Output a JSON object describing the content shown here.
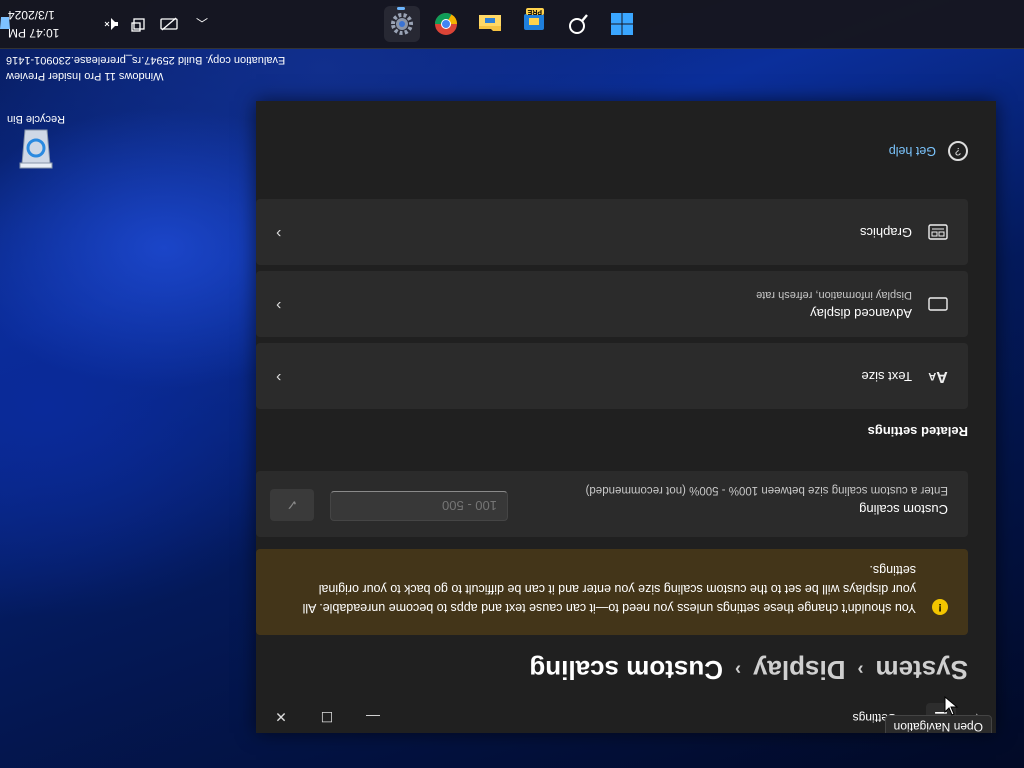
{
  "desktop": {
    "recycle_bin_label": "Recycle Bin",
    "watermark_line1": "Windows 11 Pro Insider Preview",
    "watermark_line2": "Evaluation copy. Build 25947.rs_prerelease.230901-1416"
  },
  "taskbar": {
    "apps": [
      {
        "name": "Start",
        "icon": "windows-logo-icon"
      },
      {
        "name": "Search",
        "icon": "search-icon"
      },
      {
        "name": "Store",
        "icon": "store-icon",
        "badge": "PRE"
      },
      {
        "name": "File Explorer",
        "icon": "folder-icon"
      },
      {
        "name": "Chrome",
        "icon": "chrome-icon"
      },
      {
        "name": "Settings",
        "icon": "gear-icon",
        "active": true
      }
    ],
    "clock_time": "10:47 PM",
    "clock_date": "1/3/2024"
  },
  "window": {
    "app_title": "Settings",
    "tooltip": "Open Navigation",
    "breadcrumb": [
      "System",
      "Display",
      "Custom scaling"
    ],
    "warning_text": "You shouldn't change these settings unless you need to—it can cause text and apps to become unreadable. All your displays will be set to the custom scaling size you enter and it can be difficult to go back to your original settings.",
    "custom_scaling": {
      "title": "Custom scaling",
      "description": "Enter a custom scaling size between 100% - 500% (not recommended)",
      "placeholder": "100 - 500"
    },
    "related_title": "Related settings",
    "related": [
      {
        "label": "Text size",
        "sub": "",
        "icon": "text-size-icon"
      },
      {
        "label": "Advanced display",
        "sub": "Display information, refresh rate",
        "icon": "monitor-icon"
      },
      {
        "label": "Graphics",
        "sub": "",
        "icon": "graphics-icon"
      }
    ],
    "get_help": "Get help"
  },
  "colors": {
    "accent": "#7cc6ff",
    "warning_bg": "#433519",
    "card_bg": "#2b2b2b",
    "window_bg": "#202020"
  }
}
